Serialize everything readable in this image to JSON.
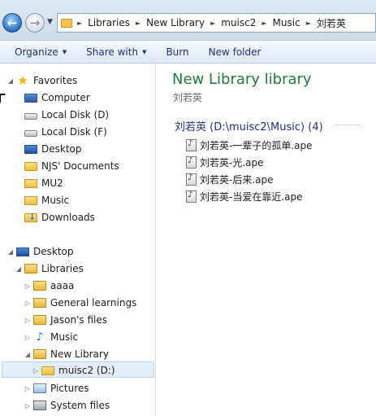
{
  "address_bar": {
    "crumbs": [
      "Libraries",
      "New Library",
      "muisc2",
      "Music",
      "刘若英"
    ]
  },
  "toolbar": {
    "organize": "Organize",
    "share_with": "Share with",
    "burn": "Burn",
    "new_folder": "New folder"
  },
  "nav": {
    "favorites": "Favorites",
    "fav_items": [
      "Computer",
      "Local Disk (D)",
      "Local Disk (F)",
      "Desktop",
      "NJS' Documents",
      "MU2",
      "Music",
      "Downloads"
    ],
    "desktop": "Desktop",
    "libraries": "Libraries",
    "lib_items": [
      "aaaa",
      "General learnings",
      "Jason's files",
      "Music",
      "New Library"
    ],
    "selected": "muisc2 (D:)",
    "after_items": [
      "Pictures",
      "System files"
    ]
  },
  "content": {
    "title": "New Library library",
    "subtitle": "刘若英",
    "group_header": "刘若英 (D:\\muisc2\\Music) (4)",
    "files": [
      "刘若英-一辈子的孤单.ape",
      "刘若英-光.ape",
      "刘若英-后来.ape",
      "刘若英-当爱在靠近.ape"
    ]
  }
}
